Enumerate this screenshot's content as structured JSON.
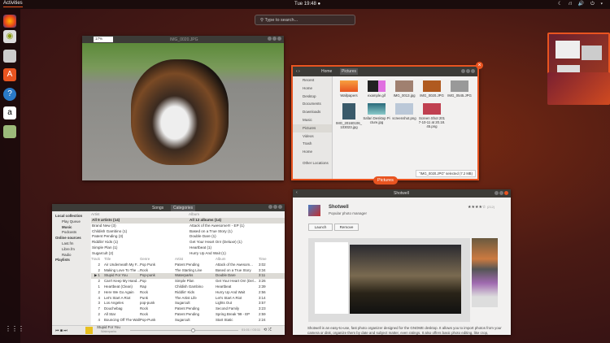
{
  "topbar": {
    "activities": "Activities",
    "clock": "Tue 19:48 ●",
    "tray": "☾ ⛙ 🔊 ⏻ ▾"
  },
  "search": {
    "placeholder": "Type to search..."
  },
  "dock": {
    "items": [
      "firefox",
      "disk",
      "software",
      "help",
      "amazon",
      "shotwell"
    ],
    "grid": "⋮⋮⋮"
  },
  "viewer": {
    "zoom": "17%",
    "title": "IMG_0020.JPG"
  },
  "files": {
    "path_home": "Home",
    "path_current": "Pictures",
    "label": "Pictures",
    "sidebar": [
      "Recent",
      "Home",
      "Desktop",
      "Documents",
      "Downloads",
      "Music",
      "Pictures",
      "Videos",
      "Trash",
      "Home",
      "Other Locations"
    ],
    "items": [
      "Wallpapers",
      "example.gif",
      "IMG_0013.jpg",
      "IMG_0020.JPG",
      "IMG_0545.JPG",
      "IMG_20160106_103023.jpg",
      "Safari Desktop Picture.jpg",
      "screenshot.png",
      "Screen Shot 2017-10-11 at 20.18.45.png"
    ],
    "status": "\"IMG_0020.JPG\" selected (7.2 MB)"
  },
  "music": {
    "tabs": [
      "Songs",
      "Categories"
    ],
    "sidebar": {
      "local": "Local collection",
      "local_items": [
        "Play Queue",
        "Music",
        "Podcasts"
      ],
      "online": "Online sources",
      "online_items": [
        "Last.fm",
        "Libre.fm",
        "Radio"
      ],
      "playlists": "Playlists"
    },
    "artist_header": "Artist",
    "album_header": "Album",
    "artists": [
      "All 9 artists (14)",
      "Brand New (3)",
      "Childish Gambino (1)",
      "Patent Pending (3)",
      "Riddlin' Kids (1)",
      "Simple Plan (1)",
      "Sugarcult (2)"
    ],
    "albums": [
      "All 12 albums (14)",
      "Attack of the Awesome!!! - EP (1)",
      "Based on a True Story (1)",
      "Double Dare (1)",
      "Get Your Heart On! (Deluxe) (1)",
      "Heartbeat (1)",
      "Hurry Up And Wait (1)"
    ],
    "columns": [
      "Track",
      "Title",
      "Genre",
      "Artist",
      "Album",
      "Time"
    ],
    "tracks": [
      [
        "2",
        "Air Underneath My F...",
        "Pop Punk",
        "Patent Pending",
        "Attack of the Awesom...",
        "3:02"
      ],
      [
        "2",
        "Making Love To The ...",
        "Rock",
        "The Starting Line",
        "Based on a True Story",
        "3:34"
      ],
      [
        "▶ 1",
        "Stupid For You",
        "Pop-punk",
        "Waterparks",
        "Double Dare",
        "3:11"
      ],
      [
        "2",
        "Can't Keep My Hand...",
        "Pop",
        "Simple Plan",
        "Get Your Heart On! (Del...",
        "3:26"
      ],
      [
        "1",
        "Heartbeat (Clean)",
        "Rap",
        "Childish Gambino",
        "Heartbeat",
        "2:39"
      ],
      [
        "2",
        "Here We Go Again",
        "Rock",
        "Riddlin' Kids",
        "Hurry Up And Wait",
        "2:56"
      ],
      [
        "4",
        "Let's Start A Riot",
        "Punk",
        "The Artist Life",
        "Let's Start A Riot",
        "3:14"
      ],
      [
        "3",
        "Los Angeles",
        "pop-punk",
        "Sugarcult",
        "Lights Out",
        "3:57"
      ],
      [
        "7",
        "Douchebag",
        "Rock",
        "Patent Pending",
        "Second Family",
        "3:23"
      ],
      [
        "2",
        "All Star",
        "Rock",
        "Patent Pending",
        "Spring Break '99 - EP",
        "2:59"
      ],
      [
        "4",
        "Bouncing Off The Walls",
        "Pop-Punk",
        "Sugarcult",
        "Start Static",
        "2:24"
      ]
    ],
    "now_title": "Stupid For You",
    "now_artist": "Waterparks",
    "time": "01:01 / 03:11",
    "progress": 0.58
  },
  "software": {
    "title": "Shotwell",
    "app": "Shotwell",
    "subtitle": "Popular photo manager",
    "launch": "Launch",
    "remove": "Remove",
    "stars": "★★★★☆",
    "count": "(212)",
    "desc": "Shotwell is an easy-to-use, fast photo organizer designed for the GNOME desktop. It allows you to import photos from your camera or disk, organize them by date and subject matter, even ratings. It also offers basic photo editing, like crop,"
  },
  "colors": {
    "accent": "#e95420",
    "header": "#3c3b37"
  }
}
